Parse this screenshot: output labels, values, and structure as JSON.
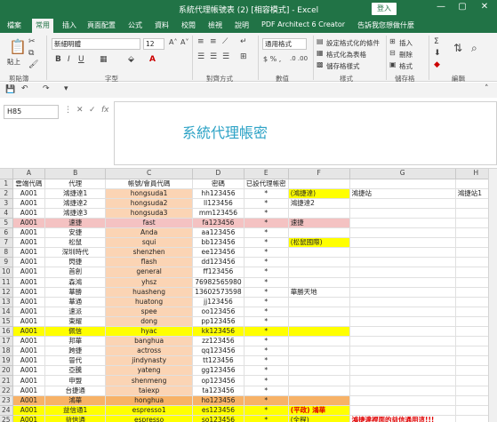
{
  "titlebar": {
    "title": "系統代理帳號表 (2) [相容模式] - Excel",
    "login": "登入",
    "min": "—",
    "restore": "▢",
    "close": "✕"
  },
  "menu": [
    "檔案",
    "常用",
    "插入",
    "頁面配置",
    "公式",
    "資料",
    "校閱",
    "檢視",
    "說明",
    "PDF Architect 6 Creator",
    "告訴我您想做什麼"
  ],
  "ribbon": {
    "paste": "貼上",
    "clipboard": "剪貼簿",
    "font_name": "新細明體",
    "font_size": "12",
    "font_group": "字型",
    "align_group": "對齊方式",
    "number_format": "通用格式",
    "number_group": "數值",
    "cond_format": "設定格式化的條件",
    "as_table": "格式化為表格",
    "cell_styles": "儲存格樣式",
    "styles_group": "樣式",
    "insert": "插入",
    "delete": "刪除",
    "format": "格式",
    "cells_group": "儲存格",
    "editing_group": "編輯"
  },
  "formula": {
    "namebox": "H85",
    "fx": "fx",
    "cancel": "✕",
    "confirm": "✓",
    "content": "系統代理帳密"
  },
  "columns": [
    "A",
    "B",
    "C",
    "D",
    "E",
    "F",
    "G",
    "H"
  ],
  "rows": [
    {
      "n": "1",
      "a": "雲端代碼",
      "b": "代理",
      "c": "帳號/會員代碼",
      "d": "密碼",
      "e": "已設代理帳密",
      "f": "",
      "g": "",
      "h": "",
      "style": ""
    },
    {
      "n": "2",
      "a": "A001",
      "b": "鴻捷達1",
      "c": "hongsuda1",
      "d": "hh123456",
      "e": "*",
      "f": "(鴻捷達)",
      "g": "鴻捷站",
      "h": "鴻捷站1",
      "style": "",
      "fstyle": "yel"
    },
    {
      "n": "3",
      "a": "A001",
      "b": "鴻捷達2",
      "c": "hongsuda2",
      "d": "ll123456",
      "e": "*",
      "f": "鴻捷達2",
      "g": "",
      "h": "",
      "style": ""
    },
    {
      "n": "4",
      "a": "A001",
      "b": "鴻捷達3",
      "c": "hongsuda3",
      "d": "mm123456",
      "e": "*",
      "f": "",
      "g": "",
      "h": "",
      "style": ""
    },
    {
      "n": "5",
      "a": "A001",
      "b": "速捷",
      "c": "fast",
      "d": "fa123456",
      "e": "*",
      "f": "速捷",
      "g": "",
      "h": "",
      "style": "pink"
    },
    {
      "n": "6",
      "a": "A001",
      "b": "安捷",
      "c": "Anda",
      "d": "aa123456",
      "e": "*",
      "f": "",
      "g": "",
      "h": "",
      "style": ""
    },
    {
      "n": "7",
      "a": "A001",
      "b": "松鼠",
      "c": "squi",
      "d": "bb123456",
      "e": "*",
      "f": "(松鼠國際)",
      "g": "",
      "h": "",
      "style": "",
      "fstyle": "yel"
    },
    {
      "n": "8",
      "a": "A001",
      "b": "深圳時代",
      "c": "shenzhen",
      "d": "ee123456",
      "e": "*",
      "f": "",
      "g": "",
      "h": "",
      "style": ""
    },
    {
      "n": "9",
      "a": "A001",
      "b": "閃捷",
      "c": "flash",
      "d": "dd123456",
      "e": "*",
      "f": "",
      "g": "",
      "h": "",
      "style": ""
    },
    {
      "n": "10",
      "a": "A001",
      "b": "首創",
      "c": "general",
      "d": "ff123456",
      "e": "*",
      "f": "",
      "g": "",
      "h": "",
      "style": ""
    },
    {
      "n": "11",
      "a": "A001",
      "b": "森鴻",
      "c": "yhsz",
      "d": "76982565980",
      "e": "*",
      "f": "",
      "g": "",
      "h": "",
      "style": ""
    },
    {
      "n": "12",
      "a": "A001",
      "b": "華勝",
      "c": "huasheng",
      "d": "13602573598",
      "e": "*",
      "f": "華勝天地",
      "g": "",
      "h": "",
      "style": ""
    },
    {
      "n": "13",
      "a": "A001",
      "b": "華通",
      "c": "huatong",
      "d": "jj123456",
      "e": "*",
      "f": "",
      "g": "",
      "h": "",
      "style": ""
    },
    {
      "n": "14",
      "a": "A001",
      "b": "速派",
      "c": "spee",
      "d": "oo123456",
      "e": "*",
      "f": "",
      "g": "",
      "h": "",
      "style": ""
    },
    {
      "n": "15",
      "a": "A001",
      "b": "東耀",
      "c": "dong",
      "d": "pp123456",
      "e": "*",
      "f": "",
      "g": "",
      "h": "",
      "style": ""
    },
    {
      "n": "16",
      "a": "A001",
      "b": "佩信",
      "c": "hyac",
      "d": "kk123456",
      "e": "*",
      "f": "",
      "g": "",
      "h": "",
      "style": "yel"
    },
    {
      "n": "17",
      "a": "A001",
      "b": "邦華",
      "c": "banghua",
      "d": "zz123456",
      "e": "*",
      "f": "",
      "g": "",
      "h": "",
      "style": ""
    },
    {
      "n": "18",
      "a": "A001",
      "b": "跨捷",
      "c": "actross",
      "d": "qq123456",
      "e": "*",
      "f": "",
      "g": "",
      "h": "",
      "style": ""
    },
    {
      "n": "19",
      "a": "A001",
      "b": "晉代",
      "c": "jindynasty",
      "d": "tt123456",
      "e": "*",
      "f": "",
      "g": "",
      "h": "",
      "style": ""
    },
    {
      "n": "20",
      "a": "A001",
      "b": "亞騰",
      "c": "yateng",
      "d": "gg123456",
      "e": "*",
      "f": "",
      "g": "",
      "h": "",
      "style": ""
    },
    {
      "n": "21",
      "a": "A001",
      "b": "申盟",
      "c": "shenmeng",
      "d": "op123456",
      "e": "*",
      "f": "",
      "g": "",
      "h": "",
      "style": ""
    },
    {
      "n": "22",
      "a": "A001",
      "b": "台捷通",
      "c": "taiexp",
      "d": "ta123456",
      "e": "*",
      "f": "",
      "g": "",
      "h": "",
      "style": ""
    },
    {
      "n": "23",
      "a": "A001",
      "b": "鴻華",
      "c": "honghua",
      "d": "ho123456",
      "e": "*",
      "f": "",
      "g": "",
      "h": "",
      "style": "orange"
    },
    {
      "n": "24",
      "a": "A001",
      "b": "益信通1",
      "c": "espresso1",
      "d": "es123456",
      "e": "*",
      "f": "(平政) 鴻華",
      "g": "",
      "h": "",
      "style": "yel"
    },
    {
      "n": "25",
      "a": "A001",
      "b": "益信通",
      "c": "espresso",
      "d": "so123456",
      "e": "*",
      "f": "(全程)",
      "g": "鴻捷達裡面的益信通用這!!!",
      "h": "",
      "style": "yel"
    }
  ]
}
